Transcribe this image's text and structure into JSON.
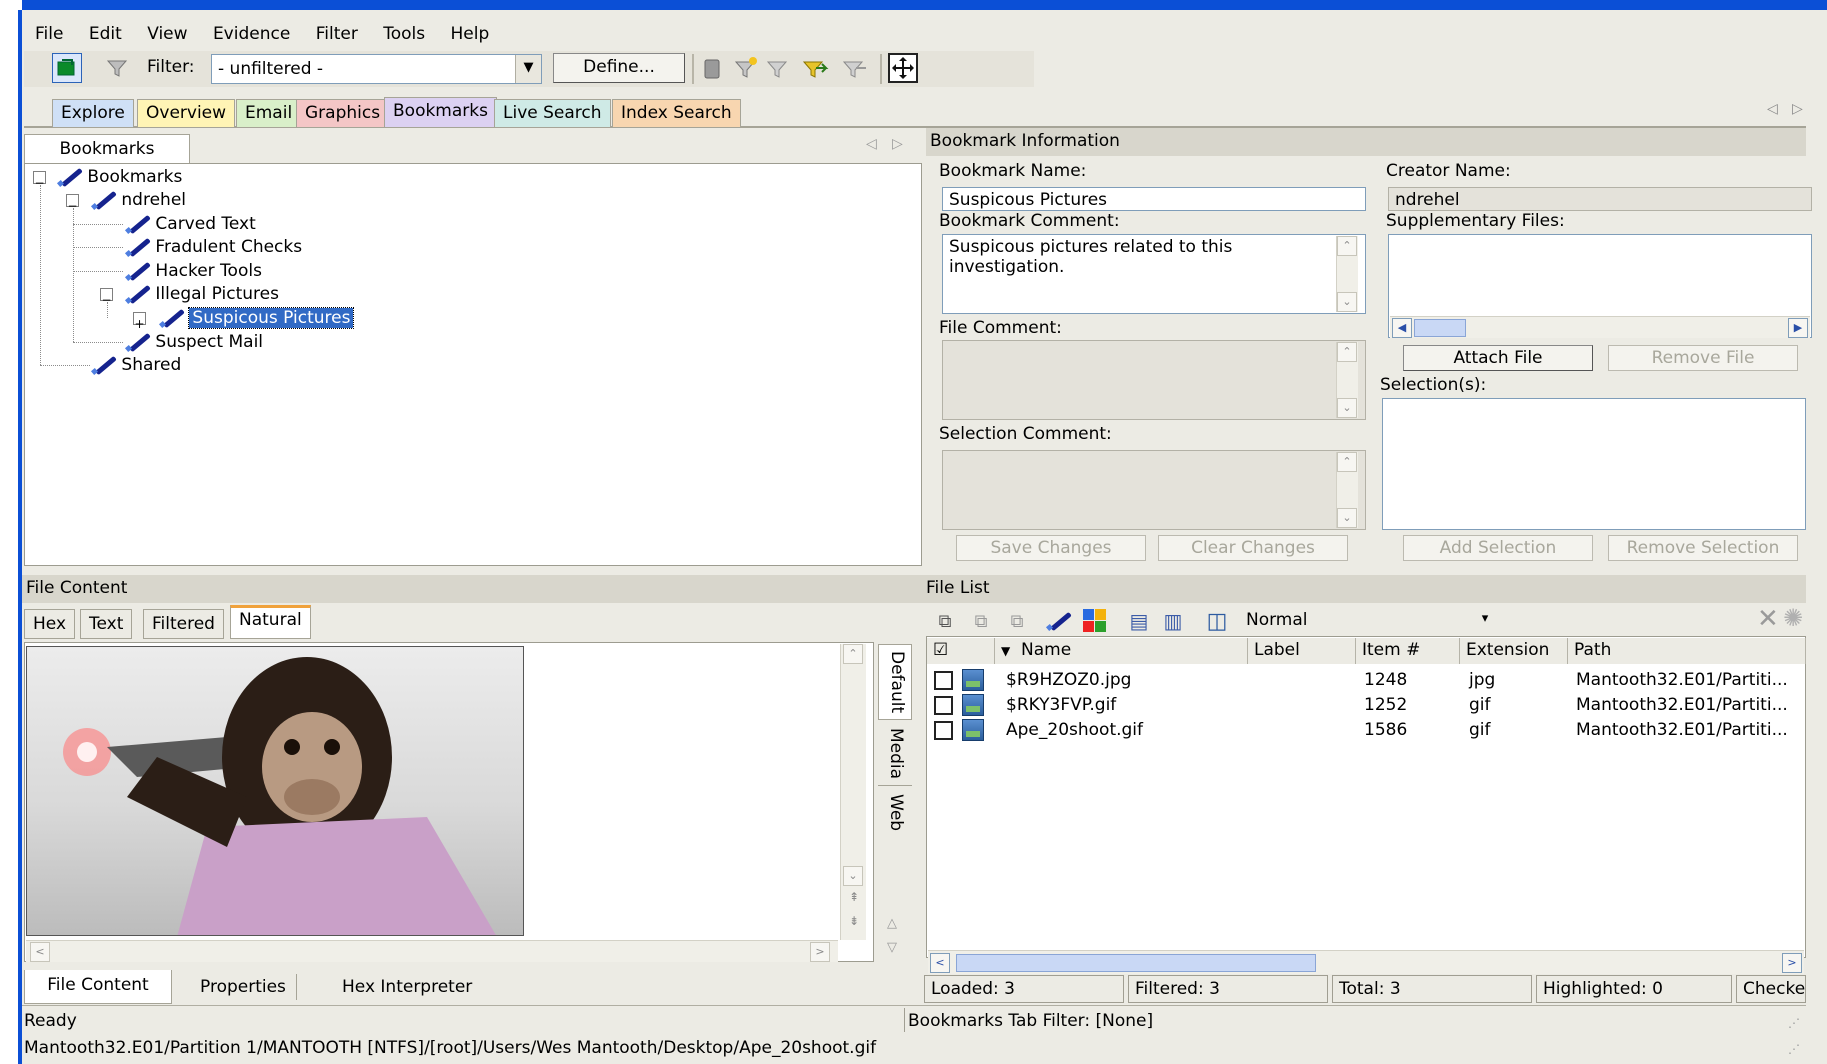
{
  "menu": [
    "File",
    "Edit",
    "View",
    "Evidence",
    "Filter",
    "Tools",
    "Help"
  ],
  "toolbar": {
    "filter_label": "Filter:",
    "filter_value": "- unfiltered -",
    "define_button": "Define..."
  },
  "main_tabs": [
    {
      "label": "Explore",
      "color": "#cfe0f6"
    },
    {
      "label": "Overview",
      "color": "#fff4b5"
    },
    {
      "label": "Email",
      "color": "#d9efc9"
    },
    {
      "label": "Graphics",
      "color": "#f4c6c6"
    },
    {
      "label": "Bookmarks",
      "color": "#dcd1f2"
    },
    {
      "label": "Live Search",
      "color": "#cfeae6"
    },
    {
      "label": "Index Search",
      "color": "#f8d6b0"
    }
  ],
  "bookmarks_panel": {
    "tab": "Bookmarks",
    "tree": [
      {
        "label": "Bookmarks"
      },
      {
        "label": "ndrehel"
      },
      {
        "label": "Carved Text"
      },
      {
        "label": "Fradulent Checks"
      },
      {
        "label": "Hacker Tools"
      },
      {
        "label": "Illegal Pictures"
      },
      {
        "label": "Suspicous Pictures",
        "selected": true
      },
      {
        "label": "Suspect Mail"
      },
      {
        "label": "Shared"
      }
    ]
  },
  "bookmark_info": {
    "header": "Bookmark Information",
    "name_label": "Bookmark Name:",
    "name_value": "Suspicous Pictures",
    "creator_label": "Creator Name:",
    "creator_value": "ndrehel",
    "comment_label": "Bookmark Comment:",
    "comment_value": "Suspicous pictures related to this investigation.",
    "supp_label": "Supplementary Files:",
    "file_comment_label": "File Comment:",
    "attach_button": "Attach File",
    "remove_file_button": "Remove File",
    "selections_label": "Selection(s):",
    "selection_comment_label": "Selection Comment:",
    "save_button": "Save Changes",
    "clear_button": "Clear Changes",
    "add_sel_button": "Add Selection",
    "remove_sel_button": "Remove Selection"
  },
  "file_content": {
    "header": "File Content",
    "tabs": [
      "Hex",
      "Text",
      "Filtered",
      "Natural"
    ],
    "side_tabs": [
      "Default",
      "Media",
      "Web"
    ],
    "bottom_tabs": [
      "File Content",
      "Properties",
      "Hex Interpreter"
    ]
  },
  "file_list": {
    "header": "File List",
    "view_mode": "Normal",
    "columns": [
      "Name",
      "Label",
      "Item #",
      "Extension",
      "Path"
    ],
    "rows": [
      {
        "name": "$R9HZOZ0.jpg",
        "label": "",
        "item": "1248",
        "ext": "jpg",
        "path": "Mantooth32.E01/Partiti..."
      },
      {
        "name": "$RKY3FVP.gif",
        "label": "",
        "item": "1252",
        "ext": "gif",
        "path": "Mantooth32.E01/Partiti..."
      },
      {
        "name": "Ape_20shoot.gif",
        "label": "",
        "item": "1586",
        "ext": "gif",
        "path": "Mantooth32.E01/Partiti..."
      }
    ],
    "status": {
      "loaded": "Loaded: 3",
      "filtered": "Filtered: 3",
      "total": "Total: 3",
      "highlighted": "Highlighted: 0",
      "checked": "Checked:"
    }
  },
  "statusbar": {
    "ready": "Ready",
    "tab_filter": "Bookmarks Tab Filter: [None]",
    "path": "Mantooth32.E01/Partition 1/MANTOOTH [NTFS]/[root]/Users/Wes Mantooth/Desktop/Ape_20shoot.gif"
  }
}
